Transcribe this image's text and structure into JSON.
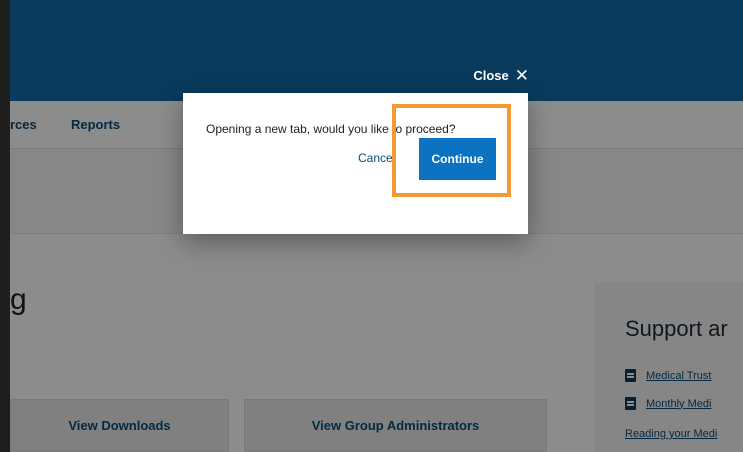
{
  "header": {
    "close_label": "Close",
    "close_icon": "✕"
  },
  "nav": {
    "items": [
      {
        "label": "rces"
      },
      {
        "label": "Reports"
      }
    ]
  },
  "page": {
    "heading_fragment": "g"
  },
  "support": {
    "title": "Support ar",
    "links": [
      {
        "label": "Medical Trust",
        "icon": "document-icon"
      },
      {
        "label": "Monthly Medi",
        "icon": "document-icon"
      },
      {
        "label": "Reading your Medi"
      }
    ]
  },
  "actions": {
    "downloads_label": "View Downloads",
    "admins_label": "View Group Administrators"
  },
  "modal": {
    "message": "Opening a new tab, would you like to proceed?",
    "cancel_label": "Cancel",
    "continue_label": "Continue"
  },
  "colors": {
    "header_bg": "#0a3a5c",
    "primary_button": "#0b73c1",
    "highlight": "#f39a35",
    "link": "#0b4c78"
  }
}
